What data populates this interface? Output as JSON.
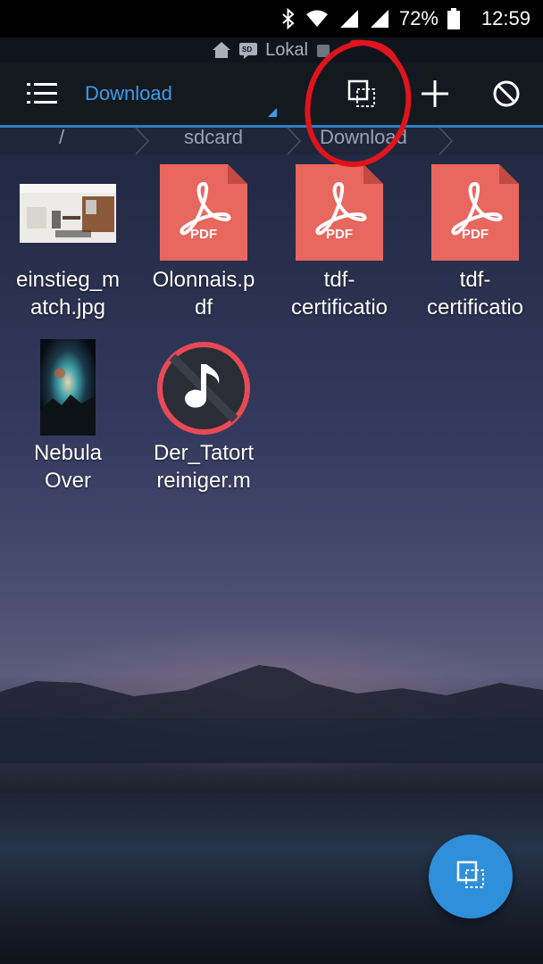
{
  "status_bar": {
    "battery_percent": "72%",
    "time": "12:59"
  },
  "location": {
    "label": "Lokal"
  },
  "toolbar": {
    "title": "Download"
  },
  "breadcrumb": {
    "items": [
      "/",
      "sdcard",
      "Download"
    ]
  },
  "files": [
    {
      "name": "einstieg_match.jpg",
      "lines": [
        "einstieg_m",
        "atch.jpg"
      ],
      "type": "image"
    },
    {
      "name": "Olonnais.pdf",
      "lines": [
        "Olonnais.p",
        "df"
      ],
      "type": "pdf",
      "badge": "PDF"
    },
    {
      "name": "tdf-certificatio",
      "lines": [
        "tdf-",
        "certificatio"
      ],
      "type": "pdf",
      "badge": "PDF"
    },
    {
      "name": "tdf-certificatio",
      "lines": [
        "tdf-",
        "certificatio"
      ],
      "type": "pdf",
      "badge": "PDF"
    },
    {
      "name": "Nebula Over",
      "lines": [
        "Nebula",
        "Over"
      ],
      "type": "image"
    },
    {
      "name": "Der_Tatortreiniger.m",
      "lines": [
        "Der_Tatort",
        "reiniger.m"
      ],
      "type": "audio"
    }
  ],
  "colors": {
    "accent": "#3d9be9",
    "pdf": "#e8675f",
    "fab": "#2f8fdb",
    "annotation": "#e0141c"
  },
  "icons": {
    "menu": "hamburger-menu-icon",
    "select": "multi-select-icon",
    "add": "plus-icon",
    "block": "no-entry-icon"
  }
}
